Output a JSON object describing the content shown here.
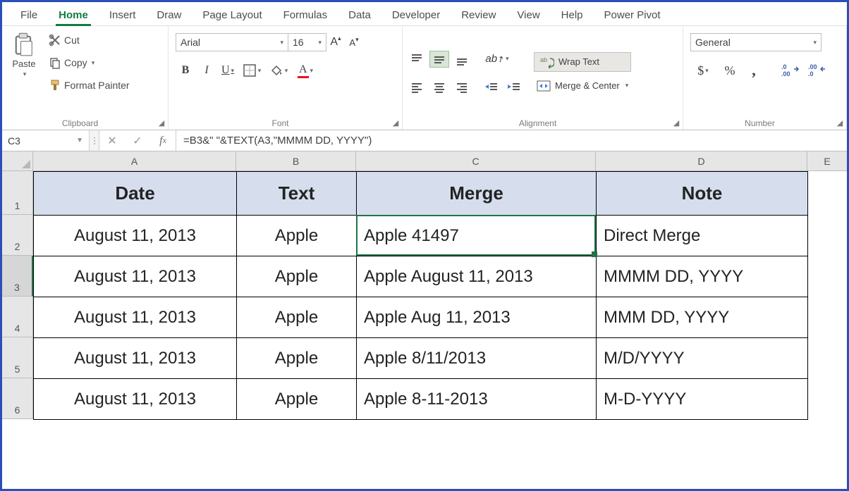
{
  "tabs": [
    "File",
    "Home",
    "Insert",
    "Draw",
    "Page Layout",
    "Formulas",
    "Data",
    "Developer",
    "Review",
    "View",
    "Help",
    "Power Pivot"
  ],
  "activeTab": "Home",
  "clipboard": {
    "paste": "Paste",
    "cut": "Cut",
    "copy": "Copy",
    "formatPainter": "Format Painter",
    "groupLabel": "Clipboard"
  },
  "font": {
    "name": "Arial",
    "size": "16",
    "groupLabel": "Font"
  },
  "alignment": {
    "wrap": "Wrap Text",
    "merge": "Merge & Center",
    "groupLabel": "Alignment"
  },
  "number": {
    "format": "General",
    "groupLabel": "Number"
  },
  "formulaBar": {
    "nameBox": "C3",
    "formula": "=B3&\" \"&TEXT(A3,\"MMMM DD, YYYY\")"
  },
  "columns": [
    "A",
    "B",
    "C",
    "D",
    "E"
  ],
  "colWidths": {
    "A": 288,
    "B": 170,
    "C": 340,
    "D": 300,
    "E": 56
  },
  "rows": [
    "1",
    "2",
    "3",
    "4",
    "5",
    "6"
  ],
  "selectedRow": "3",
  "headers": [
    "Date",
    "Text",
    "Merge",
    "Note"
  ],
  "data": [
    {
      "A": "August 11, 2013",
      "B": "Apple",
      "C": "Apple 41497",
      "D": "Direct Merge"
    },
    {
      "A": "August 11, 2013",
      "B": "Apple",
      "C": "Apple August 11, 2013",
      "D": "MMMM DD, YYYY"
    },
    {
      "A": "August 11, 2013",
      "B": "Apple",
      "C": "Apple Aug 11, 2013",
      "D": "MMM DD, YYYY"
    },
    {
      "A": "August 11, 2013",
      "B": "Apple",
      "C": "Apple 8/11/2013",
      "D": "M/D/YYYY"
    },
    {
      "A": "August 11, 2013",
      "B": "Apple",
      "C": "Apple 8-11-2013",
      "D": "M-D-YYYY"
    }
  ],
  "selection": {
    "cell": "C3",
    "colIndex": 2,
    "rowIndex": 2
  }
}
